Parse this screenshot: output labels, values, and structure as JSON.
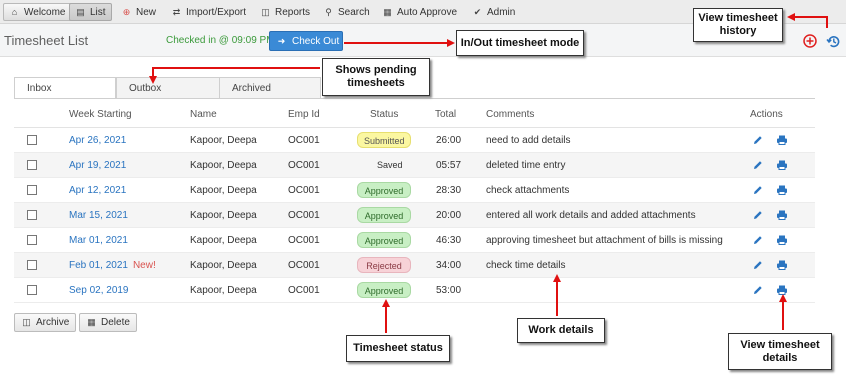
{
  "nav": {
    "welcome": "Welcome",
    "list": "List",
    "new": "New",
    "import_export": "Import/Export",
    "reports": "Reports",
    "search": "Search",
    "auto_approve": "Auto Approve",
    "admin": "Admin"
  },
  "header": {
    "title": "Timesheet List",
    "checked_in": "Checked in @ 09:09 PM",
    "checkout_label": "Check Out"
  },
  "tabs": [
    "Inbox",
    "Outbox",
    "Archived"
  ],
  "columns": {
    "week": "Week Starting",
    "name": "Name",
    "emp": "Emp Id",
    "status": "Status",
    "total": "Total",
    "comments": "Comments",
    "actions": "Actions"
  },
  "rows": [
    {
      "week": "Apr 26, 2021",
      "new": "",
      "name": "Kapoor, Deepa",
      "emp": "OC001",
      "status": "Submitted",
      "total": "26:00",
      "comment": "need to add details"
    },
    {
      "week": "Apr 19, 2021",
      "new": "",
      "name": "Kapoor, Deepa",
      "emp": "OC001",
      "status": "Saved",
      "total": "05:57",
      "comment": "deleted time entry"
    },
    {
      "week": "Apr 12, 2021",
      "new": "",
      "name": "Kapoor, Deepa",
      "emp": "OC001",
      "status": "Approved",
      "total": "28:30",
      "comment": "check attachments"
    },
    {
      "week": "Mar 15, 2021",
      "new": "",
      "name": "Kapoor, Deepa",
      "emp": "OC001",
      "status": "Approved",
      "total": "20:00",
      "comment": "entered all work details and added attachments"
    },
    {
      "week": "Mar 01, 2021",
      "new": "",
      "name": "Kapoor, Deepa",
      "emp": "OC001",
      "status": "Approved",
      "total": "46:30",
      "comment": "approving timesheet but attachment of bills is missing"
    },
    {
      "week": "Feb 01, 2021",
      "new": "New!",
      "name": "Kapoor, Deepa",
      "emp": "OC001",
      "status": "Rejected",
      "total": "34:00",
      "comment": "check time details"
    },
    {
      "week": "Sep 02, 2019",
      "new": "",
      "name": "Kapoor, Deepa",
      "emp": "OC001",
      "status": "Approved",
      "total": "53:00",
      "comment": ""
    }
  ],
  "buttons": {
    "archive": "Archive",
    "delete": "Delete"
  },
  "annotations": {
    "history": "View timesheet history",
    "inout": "In/Out timesheet mode",
    "pending": "Shows pending timesheets",
    "status": "Timesheet status",
    "work": "Work details",
    "details": "View timesheet details"
  },
  "colors": {
    "link": "#2a74c0",
    "checkout": "#3a8ad6",
    "submitted": "#fbf7a1",
    "approved": "#c8efc4",
    "rejected": "#f7d2d7",
    "arrow": "#e01010"
  }
}
